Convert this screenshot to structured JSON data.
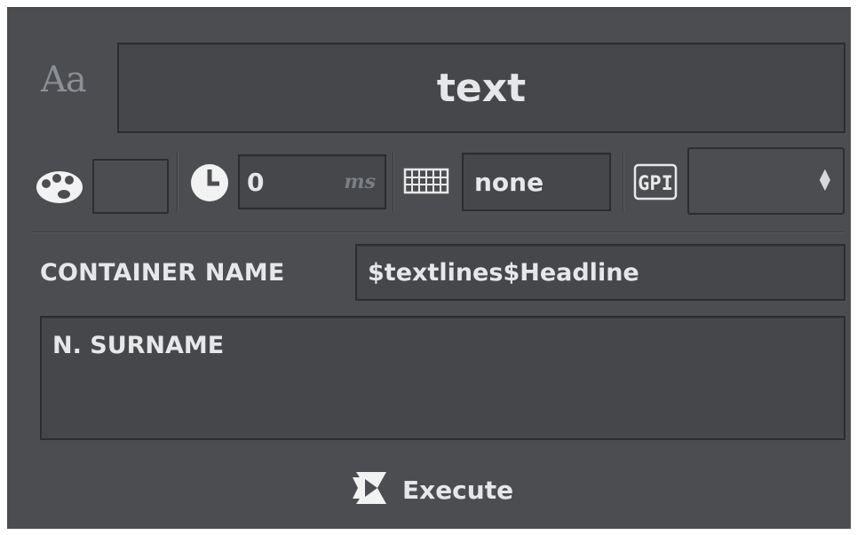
{
  "header": {
    "font_icon_label": "Aa",
    "text_value": "text"
  },
  "toolbar": {
    "palette_icon": "palette-icon",
    "clock_icon": "clock-icon",
    "duration_value": "0",
    "duration_unit": "ms",
    "keyboard_icon": "keyboard-icon",
    "shortcut_value": "none",
    "gpi_icon_label": "GPI",
    "gpi_select_value": ""
  },
  "container": {
    "label": "CONTAINER NAME",
    "value": "$textlines$Headline"
  },
  "content": {
    "text": "N. SURNAME"
  },
  "actions": {
    "execute_label": "Execute",
    "execute_icon": "execute-icon"
  },
  "colors": {
    "panel_bg": "#4b4d50",
    "field_bg": "#45474a",
    "field_border": "#2c2d2f",
    "text": "#e6e7e8"
  }
}
